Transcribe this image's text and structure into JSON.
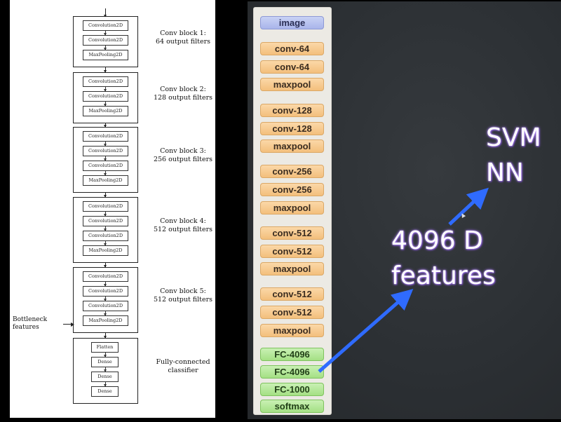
{
  "left_diagram": {
    "blocks": [
      {
        "layers": [
          "Convolution2D",
          "Convolution2D",
          "MaxPooling2D"
        ],
        "label_line1": "Conv block 1:",
        "label_line2": "64 output filters"
      },
      {
        "layers": [
          "Convolution2D",
          "Convolution2D",
          "MaxPooling2D"
        ],
        "label_line1": "Conv block 2:",
        "label_line2": "128 output filters"
      },
      {
        "layers": [
          "Convolution2D",
          "Convolution2D",
          "Convolution2D",
          "MaxPooling2D"
        ],
        "label_line1": "Conv block 3:",
        "label_line2": "256 output filters"
      },
      {
        "layers": [
          "Convolution2D",
          "Convolution2D",
          "Convolution2D",
          "MaxPooling2D"
        ],
        "label_line1": "Conv block 4:",
        "label_line2": "512 output filters"
      },
      {
        "layers": [
          "Convolution2D",
          "Convolution2D",
          "Convolution2D",
          "MaxPooling2D"
        ],
        "label_line1": "Conv block 5:",
        "label_line2": "512 output filters"
      },
      {
        "layers": [
          "Flatten",
          "Dense",
          "Dense",
          "Dense"
        ],
        "label_line1": "Fully-connected",
        "label_line2": "classifier"
      }
    ],
    "side_label_line1": "Bottleneck",
    "side_label_line2": "features"
  },
  "right_slide": {
    "layers": [
      {
        "label": "image",
        "kind": "input"
      },
      {
        "label": "conv-64",
        "kind": "conv"
      },
      {
        "label": "conv-64",
        "kind": "conv"
      },
      {
        "label": "maxpool",
        "kind": "pool"
      },
      {
        "label": "conv-128",
        "kind": "conv"
      },
      {
        "label": "conv-128",
        "kind": "conv"
      },
      {
        "label": "maxpool",
        "kind": "pool"
      },
      {
        "label": "conv-256",
        "kind": "conv"
      },
      {
        "label": "conv-256",
        "kind": "conv"
      },
      {
        "label": "maxpool",
        "kind": "pool"
      },
      {
        "label": "conv-512",
        "kind": "conv"
      },
      {
        "label": "conv-512",
        "kind": "conv"
      },
      {
        "label": "maxpool",
        "kind": "pool"
      },
      {
        "label": "conv-512",
        "kind": "conv"
      },
      {
        "label": "conv-512",
        "kind": "conv"
      },
      {
        "label": "maxpool",
        "kind": "pool"
      },
      {
        "label": "FC-4096",
        "kind": "fc"
      },
      {
        "label": "FC-4096",
        "kind": "fc"
      },
      {
        "label": "FC-1000",
        "kind": "fc"
      },
      {
        "label": "softmax",
        "kind": "fc"
      }
    ],
    "annotation_line1": "4096 D",
    "annotation_line2": "features",
    "target_line1": "SVM",
    "target_line2": "NN",
    "arrow_color": "#2f6bff",
    "text_glow_color": "#9b6ee8"
  }
}
